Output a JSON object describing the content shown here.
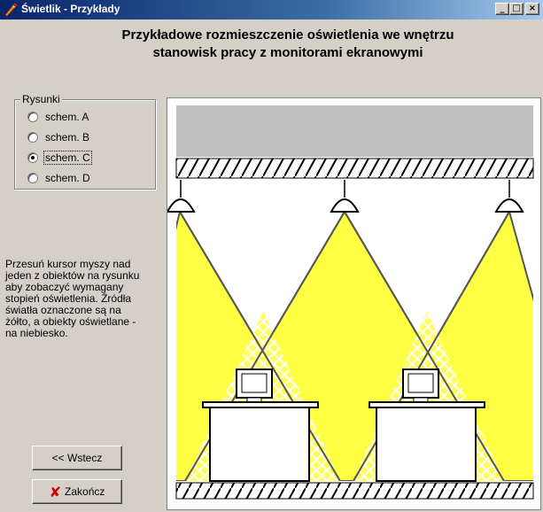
{
  "window": {
    "title": "Świetlik - Przykłady",
    "minimize_glyph": "_",
    "maximize_glyph": "□",
    "close_glyph": "×"
  },
  "heading": {
    "line1": "Przykładowe rozmieszczenie oświetlenia we wnętrzu",
    "line2": "stanowisk pracy z monitorami ekranowymi"
  },
  "drawings_group": {
    "label": "Rysunki",
    "options": [
      {
        "label": "schem. A",
        "checked": false
      },
      {
        "label": "schem. B",
        "checked": false
      },
      {
        "label": "schem. C",
        "checked": true
      },
      {
        "label": "schem. D",
        "checked": false
      }
    ]
  },
  "info_text": "Przesuń kursor myszy nad jeden z obiektów na rysunku aby zobaczyć wymagany stopień oświetlenia. Źródła światła oznaczone są na żółto, a obiekty oświetlane - na niebiesko.",
  "buttons": {
    "back_label": "<< Wstecz",
    "finish_label": "Zakończ",
    "finish_icon": "✘"
  },
  "colors": {
    "light_yellow": "#ffff44",
    "ceiling_gray": "#c0c0c0",
    "title_bar": "#0a246a"
  }
}
